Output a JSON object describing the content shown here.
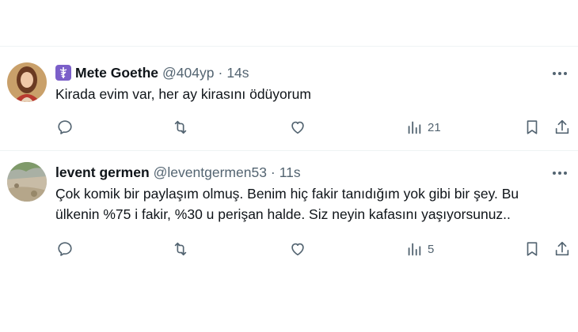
{
  "tweets": [
    {
      "name": "Mete Goethe",
      "handle": "@404yp",
      "separator": "·",
      "time": "14s",
      "text": "Kirada evim var, her ay kirasını ödüyorum",
      "views": "21",
      "avatar": "avatar-portrait-painting",
      "badge_icon": "caduceus-icon",
      "badge_color": "#7b5fc9"
    },
    {
      "name": "levent germen",
      "handle": "@leventgermen53",
      "separator": "·",
      "time": "11s",
      "text_line1": "Çok komik bir paylaşım olmuş. Benim hiç fakir tanıdığım yok gibi bir şey. Bu",
      "text_line2": "ülkenin %75 i fakir, %30 u perişan halde. Siz neyin kafasını yaşıyorsunuz..",
      "views": "5",
      "avatar": "avatar-landscape-photo"
    }
  ],
  "colors": {
    "text_primary": "#0f1419",
    "text_secondary": "#536471",
    "divider": "#eff3f4"
  }
}
